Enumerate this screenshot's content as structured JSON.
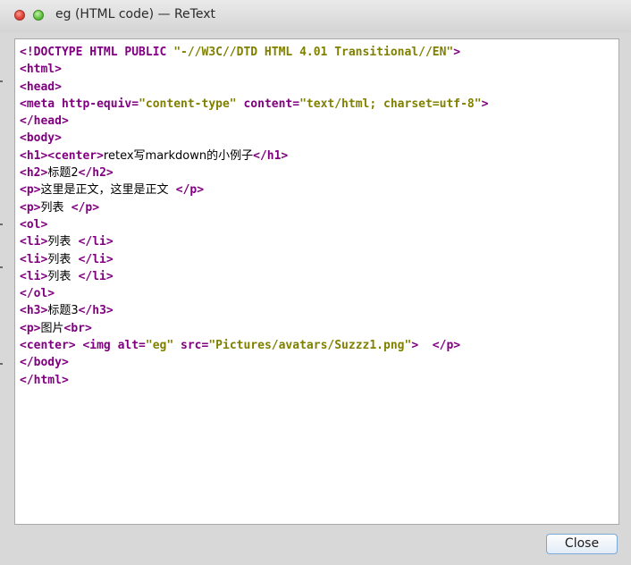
{
  "window": {
    "title": "eg (HTML code) — ReText",
    "close_button_label": "Close",
    "controls": {
      "close": "red-close-icon",
      "zoom": "green-zoom-icon"
    }
  },
  "colors": {
    "tag": "#800080",
    "string": "#808000",
    "text": "#000000",
    "button_border": "#7aa8d4"
  },
  "code": {
    "lines": [
      [
        {
          "t": "tag",
          "v": "<!DOCTYPE HTML PUBLIC "
        },
        {
          "t": "str",
          "v": "\"-//W3C//DTD HTML 4.01 Transitional//EN\""
        },
        {
          "t": "tag",
          "v": ">"
        }
      ],
      [
        {
          "t": "tag",
          "v": "<html>"
        }
      ],
      [
        {
          "t": "tag",
          "v": "<head>"
        }
      ],
      [
        {
          "t": "tag",
          "v": "<meta http-equiv="
        },
        {
          "t": "str",
          "v": "\"content-type\""
        },
        {
          "t": "tag",
          "v": " content="
        },
        {
          "t": "str",
          "v": "\"text/html; charset=utf-8\""
        },
        {
          "t": "tag",
          "v": ">"
        }
      ],
      [
        {
          "t": "tag",
          "v": "</head>"
        }
      ],
      [
        {
          "t": "tag",
          "v": "<body>"
        }
      ],
      [
        {
          "t": "tag",
          "v": "<h1><center>"
        },
        {
          "t": "txt",
          "v": "retex写markdown的小例子"
        },
        {
          "t": "tag",
          "v": "</h1>"
        }
      ],
      [
        {
          "t": "tag",
          "v": "<h2>"
        },
        {
          "t": "txt",
          "v": "标题2"
        },
        {
          "t": "tag",
          "v": "</h2>"
        }
      ],
      [
        {
          "t": "tag",
          "v": "<p>"
        },
        {
          "t": "txt",
          "v": "这里是正文，这里是正文  "
        },
        {
          "t": "tag",
          "v": "</p>"
        }
      ],
      [
        {
          "t": "tag",
          "v": "<p>"
        },
        {
          "t": "txt",
          "v": "列表  "
        },
        {
          "t": "tag",
          "v": "</p>"
        }
      ],
      [
        {
          "t": "tag",
          "v": "<ol>"
        }
      ],
      [
        {
          "t": "tag",
          "v": "<li>"
        },
        {
          "t": "txt",
          "v": "列表  "
        },
        {
          "t": "tag",
          "v": "</li>"
        }
      ],
      [
        {
          "t": "tag",
          "v": "<li>"
        },
        {
          "t": "txt",
          "v": "列表  "
        },
        {
          "t": "tag",
          "v": "</li>"
        }
      ],
      [
        {
          "t": "tag",
          "v": "<li>"
        },
        {
          "t": "txt",
          "v": "列表  "
        },
        {
          "t": "tag",
          "v": "</li>"
        }
      ],
      [
        {
          "t": "tag",
          "v": "</ol>"
        }
      ],
      [
        {
          "t": "tag",
          "v": "<h3>"
        },
        {
          "t": "txt",
          "v": "标题3"
        },
        {
          "t": "tag",
          "v": "</h3>"
        }
      ],
      [
        {
          "t": "tag",
          "v": "<p>"
        },
        {
          "t": "txt",
          "v": "图片"
        },
        {
          "t": "tag",
          "v": "<br>"
        }
      ],
      [
        {
          "t": "tag",
          "v": "<center> <img alt="
        },
        {
          "t": "str",
          "v": "\"eg\""
        },
        {
          "t": "tag",
          "v": " src="
        },
        {
          "t": "str",
          "v": "\"Pictures/avatars/Suzzz1.png\""
        },
        {
          "t": "tag",
          "v": ">  </p>"
        }
      ],
      [
        {
          "t": "tag",
          "v": "</body>"
        }
      ],
      [
        {
          "t": "tag",
          "v": "</html>"
        }
      ]
    ]
  }
}
